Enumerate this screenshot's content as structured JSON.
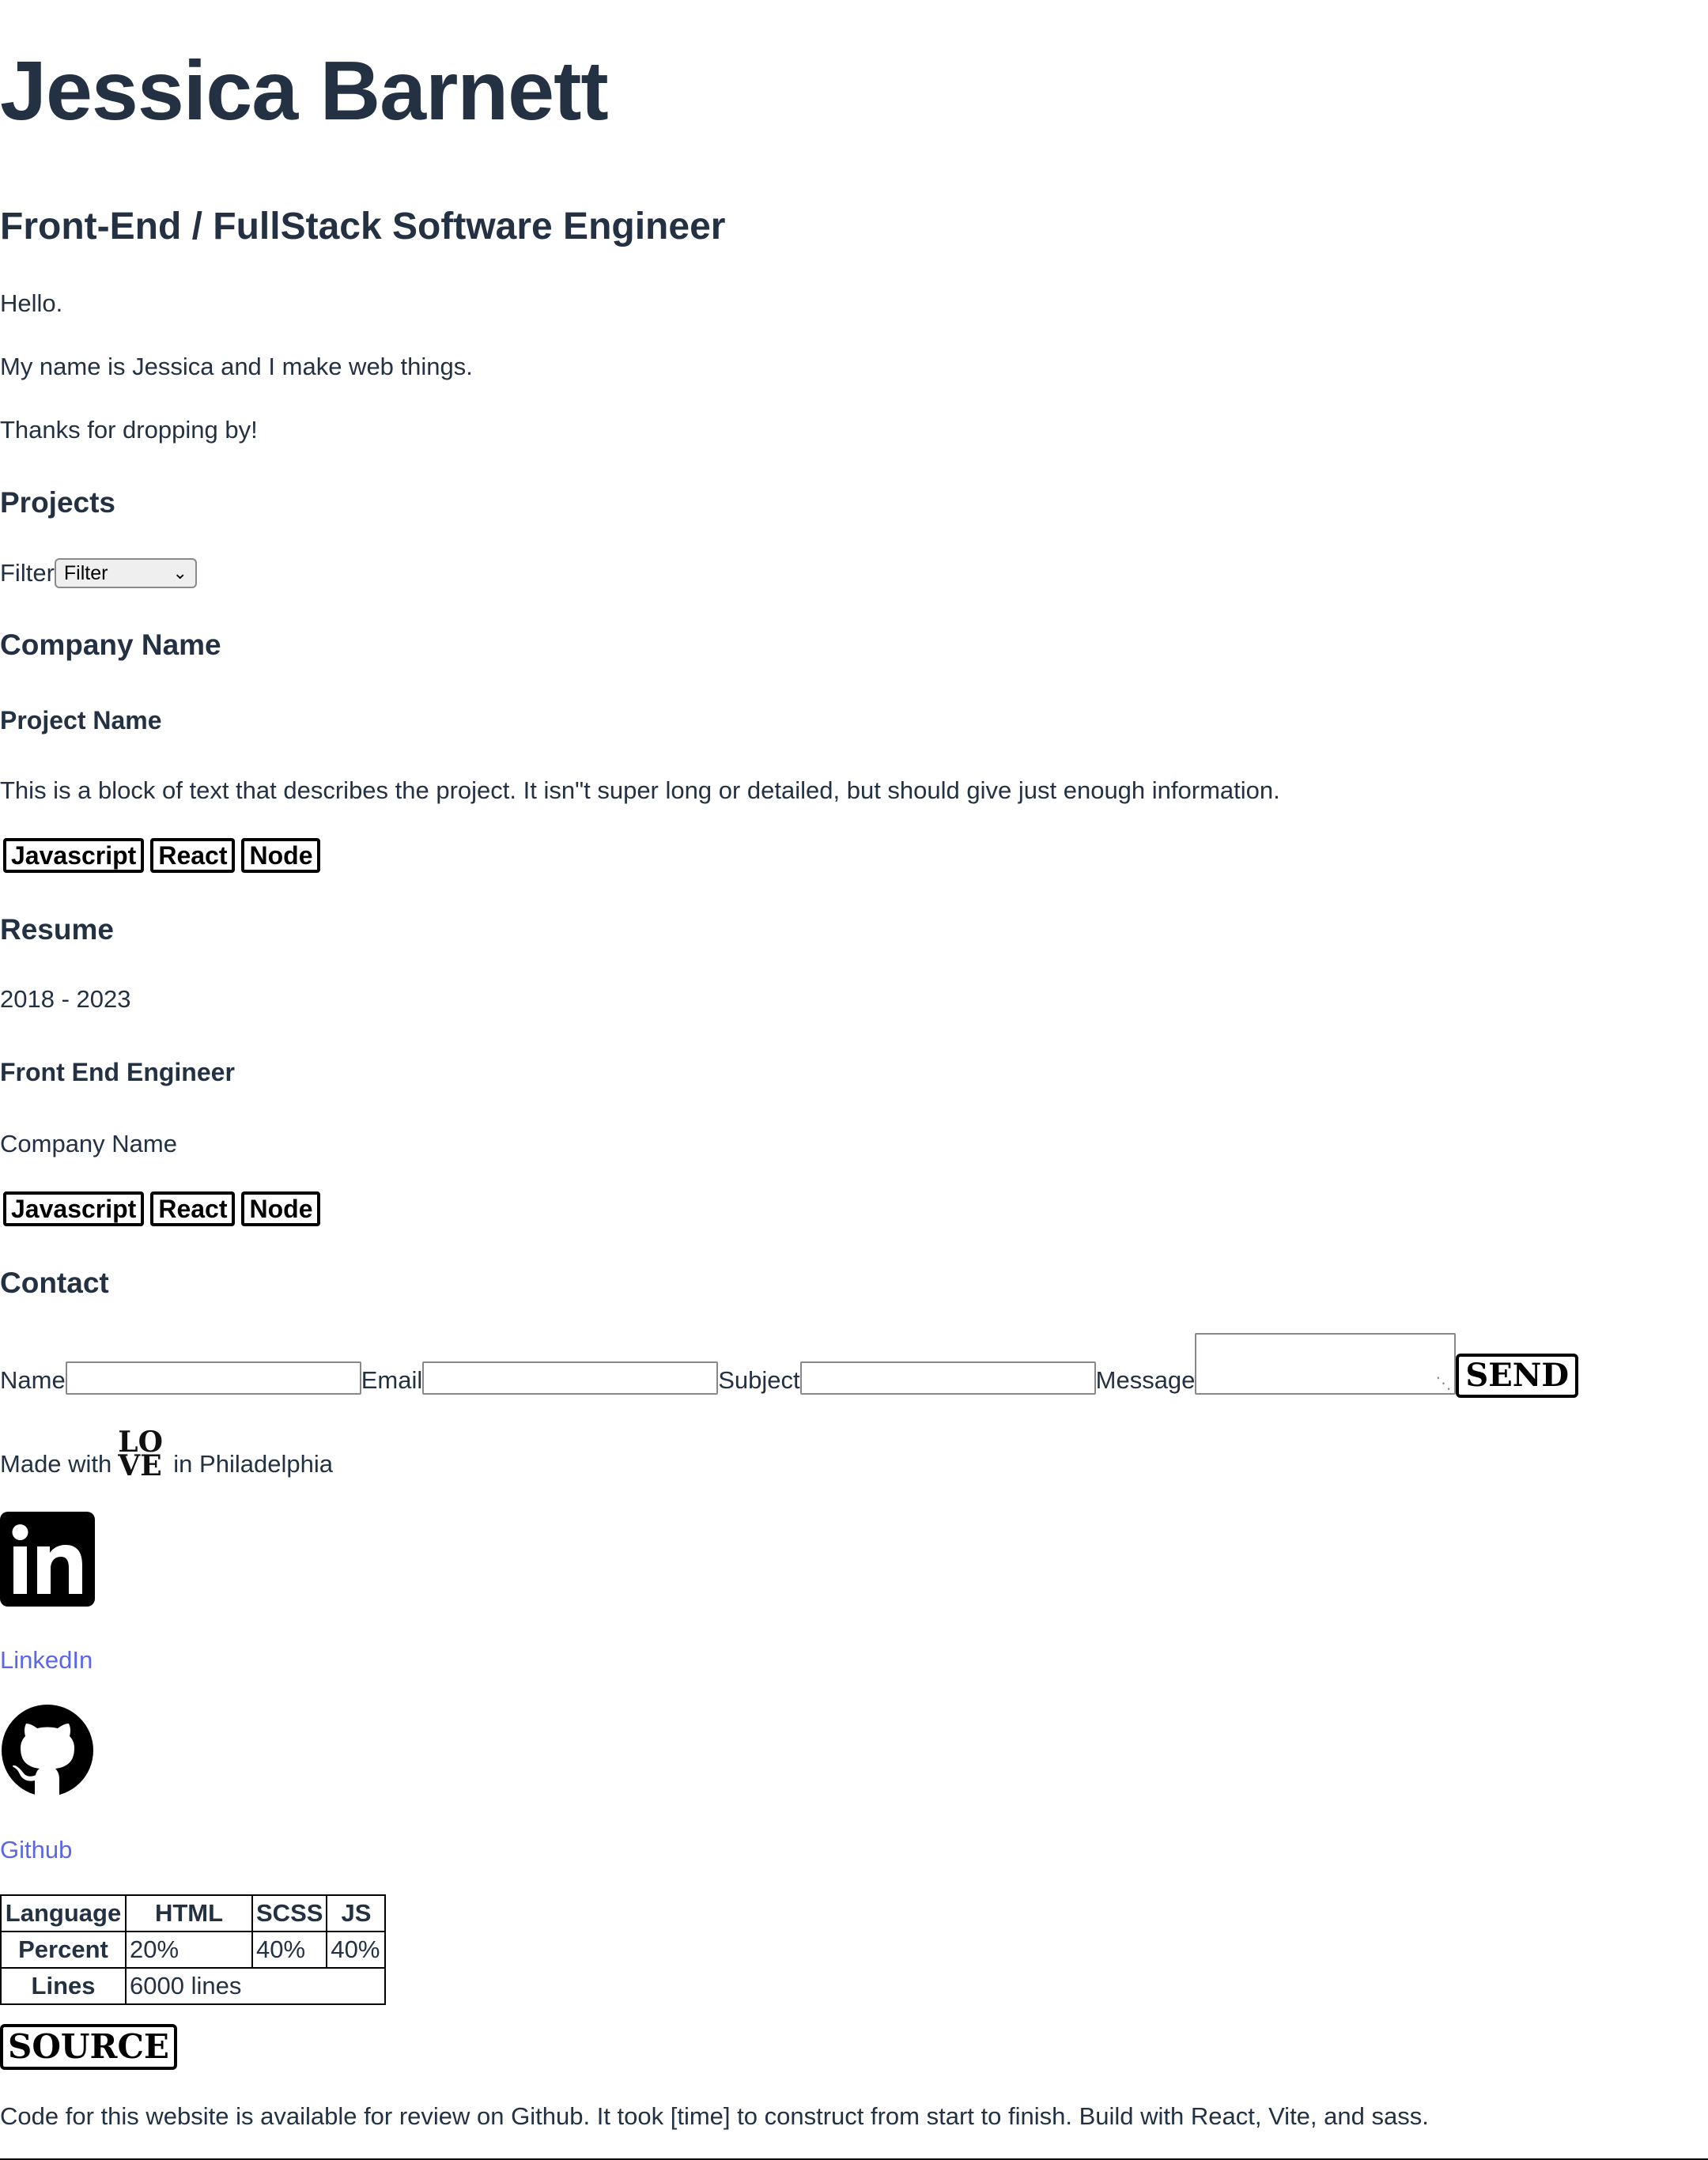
{
  "header": {
    "name": "Jessica Barnett",
    "title": "Front-End / FullStack Software Engineer"
  },
  "intro": {
    "line1": "Hello.",
    "line2": "My name is Jessica and I make web things.",
    "line3": "Thanks for dropping by!"
  },
  "projects": {
    "heading": "Projects",
    "filter_label": "Filter",
    "filter_value": "Filter",
    "company": "Company Name",
    "project_name": "Project Name",
    "description": "This is a block of text that describes the project. It isn\"t super long or detailed, but should give just enough information.",
    "tags": [
      "Javascript",
      "React",
      "Node"
    ]
  },
  "resume": {
    "heading": "Resume",
    "dates": "2018 - 2023",
    "role": "Front End Engineer",
    "company": "Company Name",
    "tags": [
      "Javascript",
      "React",
      "Node"
    ]
  },
  "contact": {
    "heading": "Contact",
    "name_label": "Name",
    "email_label": "Email",
    "subject_label": "Subject",
    "message_label": "Message",
    "send_label": "SEND"
  },
  "footer": {
    "made_prefix": "Made with",
    "made_suffix": "in Philadelphia",
    "love_top": "LO",
    "love_bottom": "VE",
    "linkedin_label": "LinkedIn",
    "github_label": "Github"
  },
  "stats": {
    "header": [
      "Language",
      "HTML",
      "SCSS",
      "JS"
    ],
    "percent_label": "Percent",
    "percents": [
      "20%",
      "40%",
      "40%"
    ],
    "lines_label": "Lines",
    "lines_value": "6000 lines"
  },
  "source": {
    "button_label": "SOURCE",
    "note": "Code for this website is available for review on Github. It took [time] to construct from start to finish. Build with React, Vite, and sass."
  },
  "colors": {
    "text": "#233143",
    "link": "#5c67e6"
  }
}
